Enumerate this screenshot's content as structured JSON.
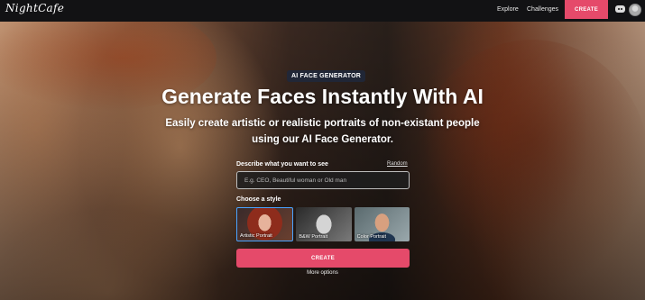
{
  "nav": {
    "logo": "NightCafe",
    "explore": "Explore",
    "challenges": "Challenges",
    "create": "CREATE"
  },
  "hero": {
    "badge": "AI FACE GENERATOR",
    "title": "Generate Faces Instantly With AI",
    "subtitle_line1": "Easily create artistic or realistic portraits of non-existant people",
    "subtitle_line2": "using our AI Face Generator."
  },
  "form": {
    "describe_label": "Describe what you want to see",
    "random": "Random",
    "placeholder": "E.g. CEO, Beautiful woman or Old man",
    "style_label": "Choose a style",
    "styles": [
      {
        "label": "Artistic Portrait",
        "selected": true
      },
      {
        "label": "B&W Portrait",
        "selected": false
      },
      {
        "label": "Color Portrait",
        "selected": false
      }
    ],
    "create": "CREATE",
    "more_options": "More options"
  },
  "colors": {
    "accent": "#e54a6a",
    "nav_bg": "#121214",
    "selected_border": "#4aa3ff"
  }
}
